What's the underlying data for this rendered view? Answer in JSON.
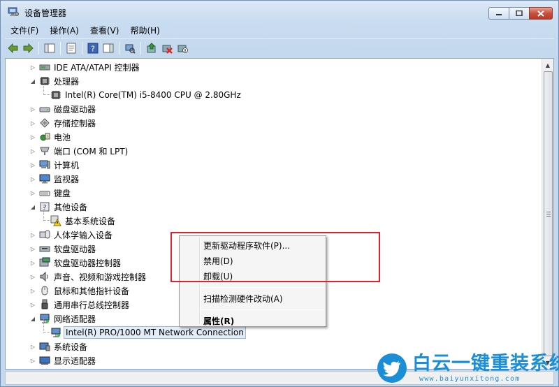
{
  "window": {
    "title": "设备管理器"
  },
  "menu": [
    {
      "id": "file",
      "label": "文件(F)"
    },
    {
      "id": "action",
      "label": "操作(A)"
    },
    {
      "id": "view",
      "label": "查看(V)"
    },
    {
      "id": "help",
      "label": "帮助(H)"
    }
  ],
  "toolbar": [
    {
      "icon": "back-arrow-icon"
    },
    {
      "icon": "forward-arrow-icon"
    },
    {
      "sep": true
    },
    {
      "icon": "show-hide-tree-icon"
    },
    {
      "sep": true
    },
    {
      "icon": "properties-icon"
    },
    {
      "sep": true
    },
    {
      "icon": "help-icon"
    },
    {
      "icon": "action-pane-icon"
    },
    {
      "sep": true
    },
    {
      "icon": "scan-hardware-icon"
    },
    {
      "sep": true
    },
    {
      "icon": "update-driver-icon"
    },
    {
      "icon": "uninstall-icon"
    },
    {
      "icon": "disable-device-icon"
    }
  ],
  "tree": [
    {
      "label": "IDE ATA/ATAPI 控制器",
      "level": 0,
      "expanded": false,
      "icon": "ide-controller-icon"
    },
    {
      "label": "处理器",
      "level": 0,
      "expanded": true,
      "icon": "processor-icon"
    },
    {
      "label": "Intel(R) Core(TM) i5-8400 CPU @ 2.80GHz",
      "level": 1,
      "icon": "cpu-icon"
    },
    {
      "label": "磁盘驱动器",
      "level": 0,
      "expanded": false,
      "icon": "disk-drive-icon"
    },
    {
      "label": "存储控制器",
      "level": 0,
      "expanded": false,
      "icon": "storage-controller-icon"
    },
    {
      "label": "电池",
      "level": 0,
      "expanded": false,
      "icon": "battery-icon"
    },
    {
      "label": "端口 (COM 和 LPT)",
      "level": 0,
      "expanded": false,
      "icon": "port-icon"
    },
    {
      "label": "计算机",
      "level": 0,
      "expanded": false,
      "icon": "computer-icon"
    },
    {
      "label": "监视器",
      "level": 0,
      "expanded": false,
      "icon": "monitor-icon"
    },
    {
      "label": "键盘",
      "level": 0,
      "expanded": false,
      "icon": "keyboard-icon"
    },
    {
      "label": "其他设备",
      "level": 0,
      "expanded": true,
      "icon": "other-devices-icon"
    },
    {
      "label": "基本系统设备",
      "level": 1,
      "icon": "warning-device-icon"
    },
    {
      "label": "人体学输入设备",
      "level": 0,
      "expanded": false,
      "icon": "hid-icon"
    },
    {
      "label": "软盘驱动器",
      "level": 0,
      "expanded": false,
      "icon": "floppy-drive-icon"
    },
    {
      "label": "软盘驱动器控制器",
      "level": 0,
      "expanded": false,
      "icon": "floppy-controller-icon"
    },
    {
      "label": "声音、视频和游戏控制器",
      "level": 0,
      "expanded": false,
      "icon": "sound-icon"
    },
    {
      "label": "鼠标和其他指针设备",
      "level": 0,
      "expanded": false,
      "icon": "mouse-icon"
    },
    {
      "label": "通用串行总线控制器",
      "level": 0,
      "expanded": false,
      "icon": "usb-icon"
    },
    {
      "label": "网络适配器",
      "level": 0,
      "expanded": true,
      "icon": "network-adapter-icon"
    },
    {
      "label": "Intel(R) PRO/1000 MT Network Connection",
      "level": 1,
      "icon": "network-card-icon",
      "selected": true
    },
    {
      "label": "系统设备",
      "level": 0,
      "expanded": false,
      "icon": "system-device-icon"
    },
    {
      "label": "显示适配器",
      "level": 0,
      "expanded": false,
      "icon": "display-adapter-icon"
    }
  ],
  "context_menu": [
    {
      "id": "update-driver",
      "label": "更新驱动程序软件(P)..."
    },
    {
      "id": "disable",
      "label": "禁用(D)"
    },
    {
      "id": "uninstall",
      "label": "卸载(U)"
    },
    {
      "sep": true
    },
    {
      "id": "scan-hardware",
      "label": "扫描检测硬件改动(A)"
    },
    {
      "sep": true
    },
    {
      "id": "properties",
      "label": "属性(R)",
      "bold": true
    }
  ],
  "watermark": {
    "title": "白云一键重装系统",
    "url": "www.baiyunxitong.com"
  }
}
